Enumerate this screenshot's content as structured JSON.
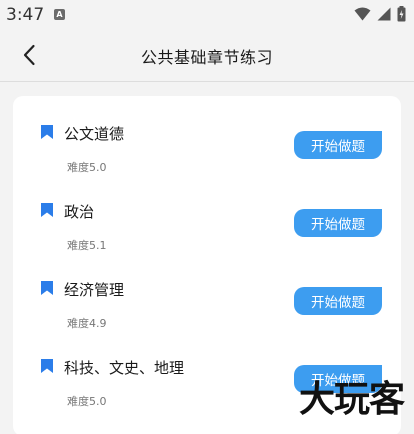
{
  "status_bar": {
    "time": "3:47",
    "notification_icon": "a-badge-icon",
    "icons": [
      "wifi-icon",
      "signal-icon",
      "battery-icon"
    ]
  },
  "header": {
    "title": "公共基础章节练习",
    "back_icon": "chevron-left-icon"
  },
  "chapters": [
    {
      "name": "公文道德",
      "difficulty": "难度5.0",
      "button_label": "开始做题"
    },
    {
      "name": "政治",
      "difficulty": "难度5.1",
      "button_label": "开始做题"
    },
    {
      "name": "经济管理",
      "difficulty": "难度4.9",
      "button_label": "开始做题"
    },
    {
      "name": "科技、文史、地理",
      "difficulty": "难度5.0",
      "button_label": "开始做题"
    }
  ],
  "watermark": "大玩客",
  "colors": {
    "accent": "#3d9df0",
    "bookmark": "#2b7de9",
    "background": "#f3f3f3",
    "card": "#ffffff"
  }
}
